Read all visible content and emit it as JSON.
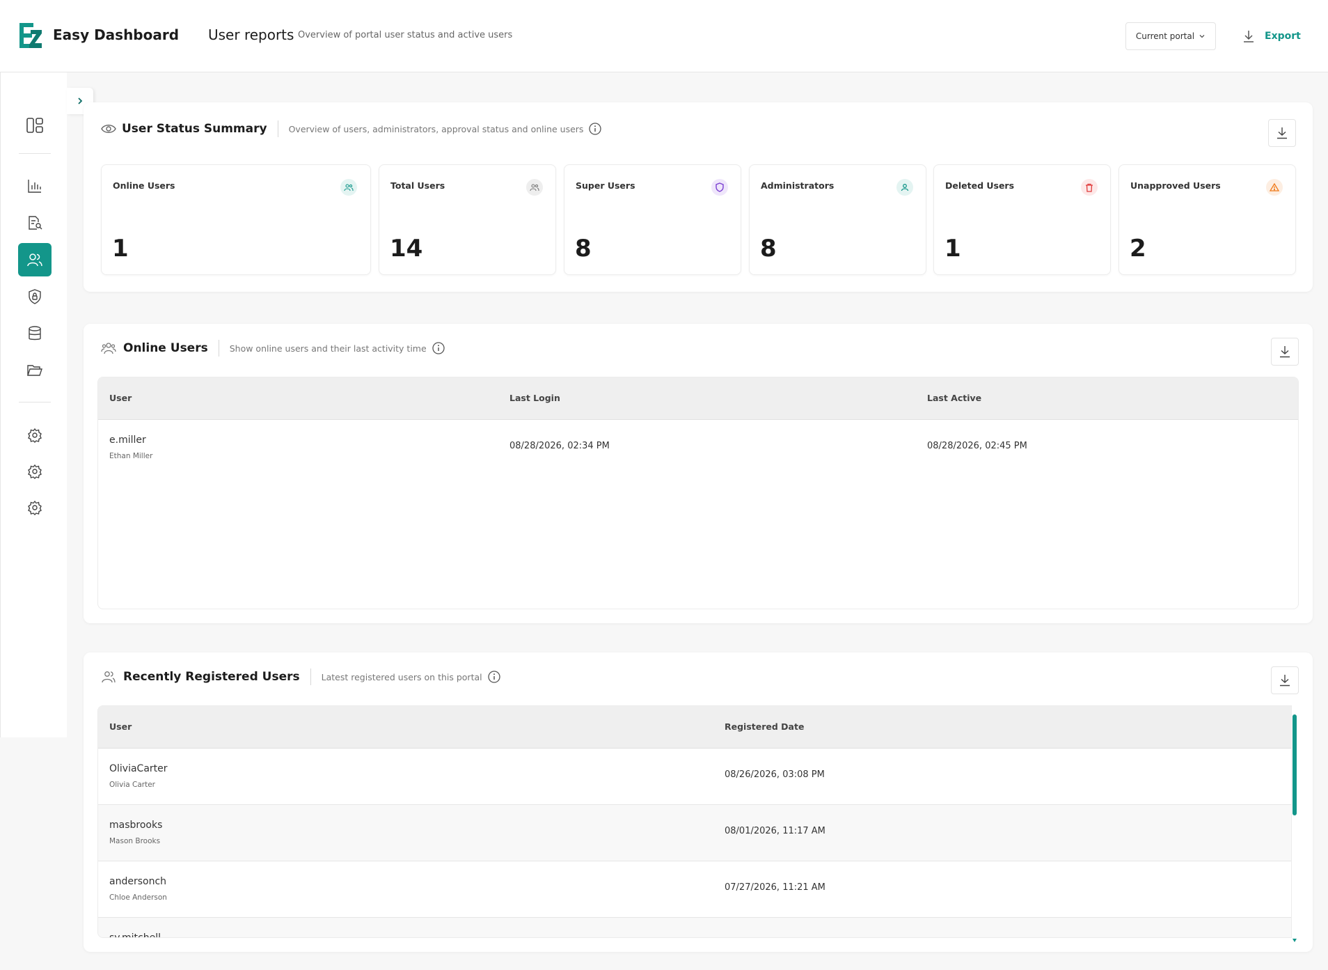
{
  "header": {
    "brand": "Easy Dashboard",
    "title": "User reports",
    "subtitle": "Overview of portal user status and active users",
    "portal_select": "Current portal",
    "export_label": "Export"
  },
  "sidebar": {
    "icons": [
      "dashboard-icon",
      "bar-chart-icon",
      "document-search-icon",
      "users-icon",
      "shield-icon",
      "database-icon",
      "folder-open-icon",
      "settings-icon",
      "settings-icon",
      "settings-icon"
    ],
    "active": "users-icon"
  },
  "summary": {
    "title": "User Status Summary",
    "description": "Overview of users, administrators, approval status and online users",
    "cards": [
      {
        "label": "Online Users",
        "value": "1",
        "icon": "users-icon",
        "color": "#13968a"
      },
      {
        "label": "Total Users",
        "value": "14",
        "icon": "users-icon",
        "color": "#777777"
      },
      {
        "label": "Super Users",
        "value": "8",
        "icon": "shield-icon",
        "color": "#7b3fd1"
      },
      {
        "label": "Administrators",
        "value": "8",
        "icon": "user-icon",
        "color": "#13968a"
      },
      {
        "label": "Deleted Users",
        "value": "1",
        "icon": "trash-icon",
        "color": "#e03a3a"
      },
      {
        "label": "Unapproved Users",
        "value": "2",
        "icon": "warning-icon",
        "color": "#f07a1a"
      }
    ]
  },
  "online": {
    "title": "Online Users",
    "description": "Show online users and their last activity time",
    "columns": [
      "User",
      "Last Login",
      "Last Active"
    ],
    "rows": [
      {
        "username": "e.miller",
        "fullname": "Ethan Miller",
        "last_login": "08/28/2026, 02:34 PM",
        "last_active": "08/28/2026, 02:45 PM"
      }
    ]
  },
  "registered": {
    "title": "Recently Registered Users",
    "description": "Latest registered users on this portal",
    "columns": [
      "User",
      "Registered Date"
    ],
    "rows": [
      {
        "username": "OliviaCarter",
        "fullname": "Olivia Carter",
        "date": "08/26/2026, 03:08 PM"
      },
      {
        "username": "masbrooks",
        "fullname": "Mason Brooks",
        "date": "08/01/2026, 11:17 AM"
      },
      {
        "username": "andersonch",
        "fullname": "Chloe Anderson",
        "date": "07/27/2026, 11:21 AM"
      },
      {
        "username": "sy.mitchell",
        "fullname": "",
        "date": ""
      }
    ]
  },
  "colors": {
    "accent": "#13968a",
    "background": "#f7f7f7"
  }
}
